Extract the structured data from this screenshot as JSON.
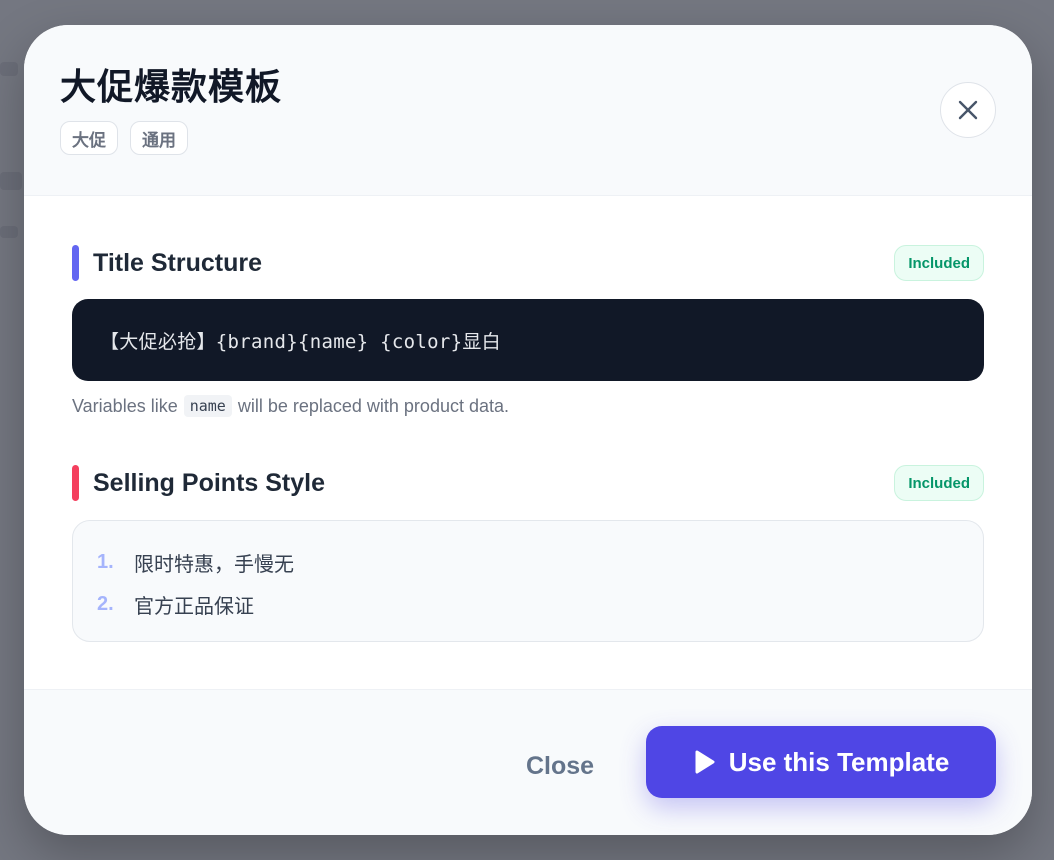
{
  "modal": {
    "title": "大促爆款模板",
    "tags": [
      "大促",
      "通用"
    ]
  },
  "title_section": {
    "heading": "Title Structure",
    "status": "Included",
    "accent_color": "#6366f1",
    "template_code": "【大促必抢】{brand}{name} {color}显白",
    "hint_prefix": "Variables like",
    "hint_variable": "name",
    "hint_suffix": "will be replaced with product data."
  },
  "selling_section": {
    "heading": "Selling Points Style",
    "status": "Included",
    "accent_color": "#f43f5e",
    "points": [
      {
        "num": "1.",
        "text": "限时特惠，手慢无"
      },
      {
        "num": "2.",
        "text": "官方正品保证"
      }
    ]
  },
  "footer": {
    "close_label": "Close",
    "use_label": "Use this Template",
    "primary_color": "#4f46e5"
  },
  "icons": {
    "close": "close-icon",
    "use": "play-icon"
  }
}
